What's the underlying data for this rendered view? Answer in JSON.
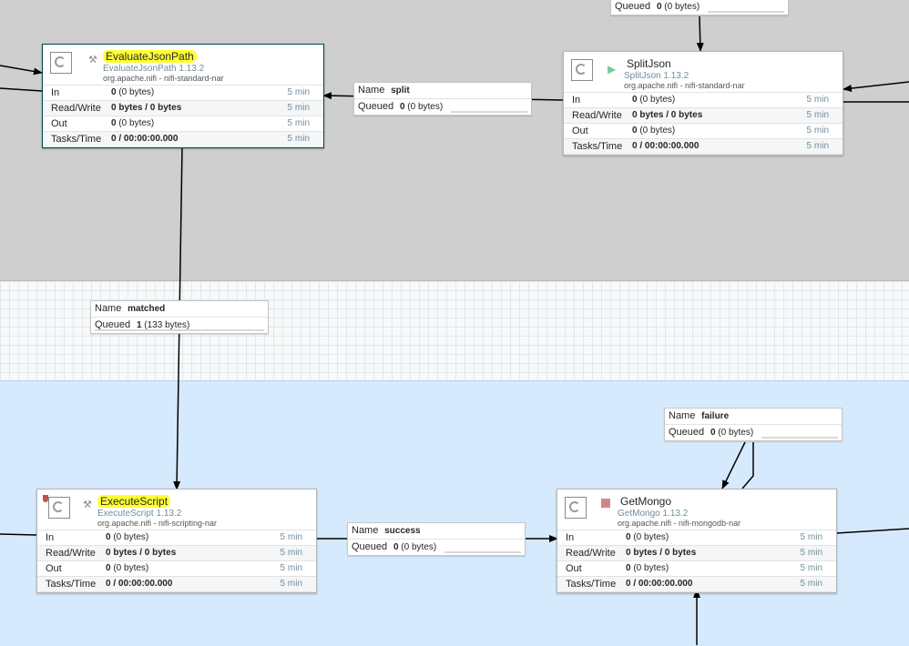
{
  "processors": {
    "evaluate": {
      "name": "EvaluateJsonPath",
      "type": "EvaluateJsonPath 1.13.2",
      "bundle": "org.apache.nifi - nifi-standard-nar",
      "state_icon": "invalid-wand-icon",
      "rows": [
        {
          "label": "In",
          "count": "0",
          "detail": "(0 bytes)",
          "time": "5 min"
        },
        {
          "label": "Read/Write",
          "count": "0 bytes / 0 bytes",
          "detail": "",
          "time": "5 min"
        },
        {
          "label": "Out",
          "count": "0",
          "detail": "(0 bytes)",
          "time": "5 min"
        },
        {
          "label": "Tasks/Time",
          "count": "0 / 00:00:00.000",
          "detail": "",
          "time": "5 min"
        }
      ]
    },
    "splitjson": {
      "name": "SplitJson",
      "type": "SplitJson 1.13.2",
      "bundle": "org.apache.nifi - nifi-standard-nar",
      "state_icon": "running-play-icon",
      "rows": [
        {
          "label": "In",
          "count": "0",
          "detail": "(0 bytes)",
          "time": "5 min"
        },
        {
          "label": "Read/Write",
          "count": "0 bytes / 0 bytes",
          "detail": "",
          "time": "5 min"
        },
        {
          "label": "Out",
          "count": "0",
          "detail": "(0 bytes)",
          "time": "5 min"
        },
        {
          "label": "Tasks/Time",
          "count": "0 / 00:00:00.000",
          "detail": "",
          "time": "5 min"
        }
      ]
    },
    "execute": {
      "name": "ExecuteScript",
      "type": "ExecuteScript 1.13.2",
      "bundle": "org.apache.nifi - nifi-scripting-nar",
      "state_icon": "invalid-wand-icon",
      "rows": [
        {
          "label": "In",
          "count": "0",
          "detail": "(0 bytes)",
          "time": "5 min"
        },
        {
          "label": "Read/Write",
          "count": "0 bytes / 0 bytes",
          "detail": "",
          "time": "5 min"
        },
        {
          "label": "Out",
          "count": "0",
          "detail": "(0 bytes)",
          "time": "5 min"
        },
        {
          "label": "Tasks/Time",
          "count": "0 / 00:00:00.000",
          "detail": "",
          "time": "5 min"
        }
      ]
    },
    "getmongo": {
      "name": "GetMongo",
      "type": "GetMongo 1.13.2",
      "bundle": "org.apache.nifi - nifi-mongodb-nar",
      "state_icon": "stopped-square-icon",
      "rows": [
        {
          "label": "In",
          "count": "0",
          "detail": "(0 bytes)",
          "time": "5 min"
        },
        {
          "label": "Read/Write",
          "count": "0 bytes / 0 bytes",
          "detail": "",
          "time": "5 min"
        },
        {
          "label": "Out",
          "count": "0",
          "detail": "(0 bytes)",
          "time": "5 min"
        },
        {
          "label": "Tasks/Time",
          "count": "0 / 00:00:00.000",
          "detail": "",
          "time": "5 min"
        }
      ]
    }
  },
  "connections": {
    "top": {
      "queued_label": "Queued",
      "queued_count": "0",
      "queued_bytes": "(0 bytes)"
    },
    "split": {
      "name_label": "Name",
      "name": "split",
      "queued_label": "Queued",
      "queued_count": "0",
      "queued_bytes": "(0 bytes)"
    },
    "matched": {
      "name_label": "Name",
      "name": "matched",
      "queued_label": "Queued",
      "queued_count": "1",
      "queued_bytes": "(133 bytes)"
    },
    "success": {
      "name_label": "Name",
      "name": "success",
      "queued_label": "Queued",
      "queued_count": "0",
      "queued_bytes": "(0 bytes)"
    },
    "failure": {
      "name_label": "Name",
      "name": "failure",
      "queued_label": "Queued",
      "queued_count": "0",
      "queued_bytes": "(0 bytes)"
    }
  },
  "colors": {
    "highlight": "#ffff33",
    "process_group_gray": "#cfcfcf",
    "process_group_blue": "#d6eafd",
    "running": "#7dc7a0",
    "stopped": "#d18686",
    "invalid_badge": "#ba554a"
  }
}
